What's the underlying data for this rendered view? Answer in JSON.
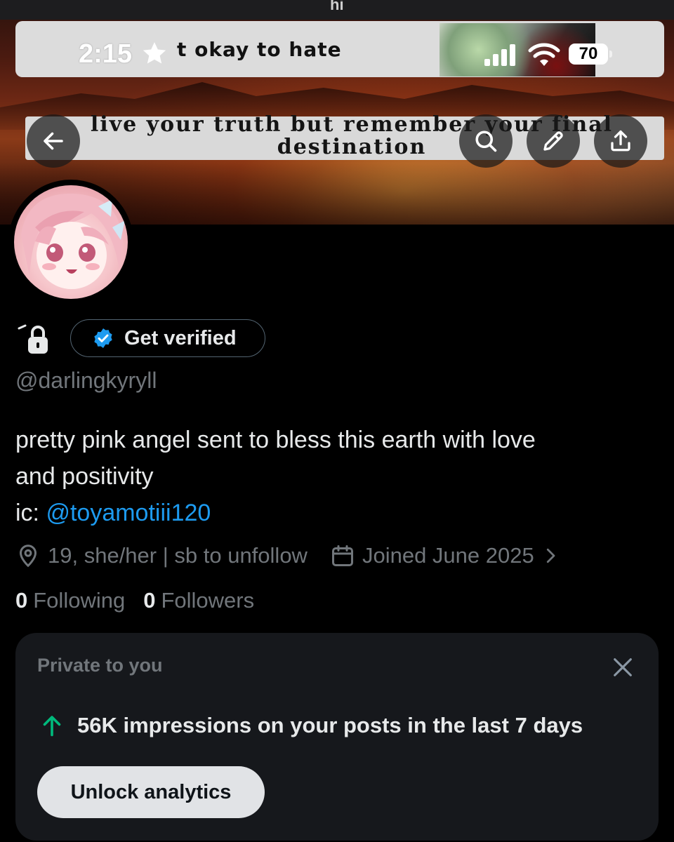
{
  "status_bar": {
    "time": "2:15",
    "battery": "70"
  },
  "banner": {
    "top_text": "hi",
    "meme_line1": "t okay to hate",
    "meme_line2": "live your truth but remember your final destination"
  },
  "nav": {
    "back_icon": "arrow-left-icon",
    "search_icon": "search-icon",
    "edit_icon": "pencil-icon",
    "share_icon": "share-icon"
  },
  "profile": {
    "verify_label": "Get verified",
    "handle": "@darlingkyryll",
    "bio_line1": "pretty pink angel sent to bless this earth with love",
    "bio_line2": "and positivity",
    "bio_line3_prefix": "ic: ",
    "bio_line3_link": "@toyamotiii120",
    "location": "19, she/her | sb to unfollow",
    "joined": "Joined June 2025",
    "following_count": "0",
    "following_label": "Following",
    "followers_count": "0",
    "followers_label": "Followers"
  },
  "private_card": {
    "title": "Private to you",
    "stat": "56K impressions on your posts in the last 7 days",
    "button": "Unlock analytics"
  },
  "colors": {
    "accent": "#1d9bf0",
    "up_arrow": "#00ba7c",
    "secondary_text": "#71767b",
    "card_bg": "#16181c"
  }
}
